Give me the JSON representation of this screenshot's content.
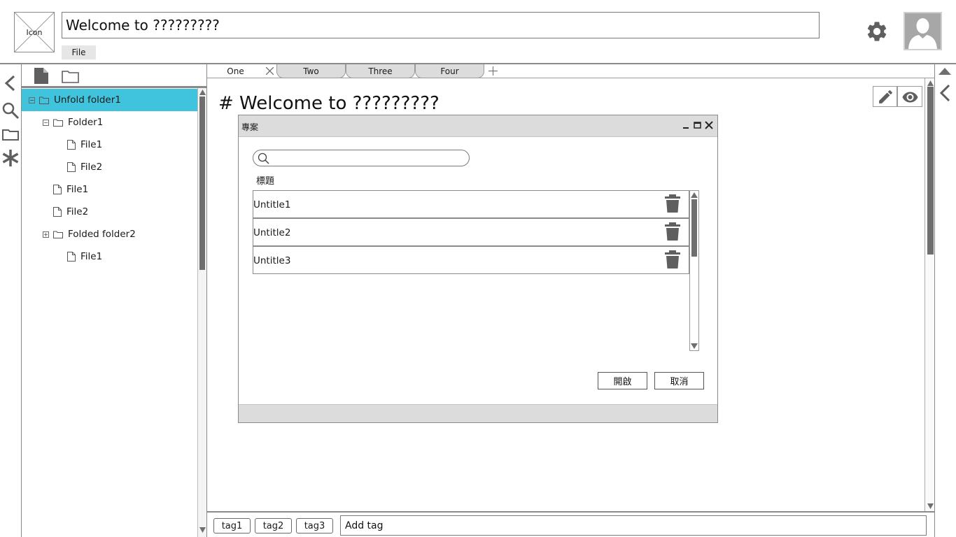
{
  "header": {
    "app_icon_label": "Icon",
    "title_value": "Welcome to ?????????",
    "menu": {
      "file_label": "File"
    }
  },
  "sidebar": {
    "tree": [
      {
        "label": "Unfold folder1",
        "type": "folder",
        "toggle": "−",
        "depth": 0,
        "selected": true
      },
      {
        "label": "Folder1",
        "type": "folder",
        "toggle": "−",
        "depth": 1
      },
      {
        "label": "File1",
        "type": "file",
        "depth": 2
      },
      {
        "label": "File2",
        "type": "file",
        "depth": 2
      },
      {
        "label": "File1",
        "type": "file",
        "depth": 1
      },
      {
        "label": "File2",
        "type": "file",
        "depth": 1
      },
      {
        "label": "Folded folder2",
        "type": "folder",
        "toggle": "+",
        "depth": 1
      },
      {
        "label": "File1",
        "type": "file",
        "depth": 2
      }
    ]
  },
  "tabs": [
    {
      "label": "One",
      "active": true
    },
    {
      "label": "Two"
    },
    {
      "label": "Three"
    },
    {
      "label": "Four"
    }
  ],
  "main": {
    "heading": "# Welcome to ?????????"
  },
  "dialog": {
    "title": "專案",
    "search_value": "",
    "list_header": "標題",
    "items": [
      "Untitle1",
      "Untitle2",
      "Untitle3"
    ],
    "open_label": "開啟",
    "cancel_label": "取消"
  },
  "tagbar": {
    "tags": [
      "tag1",
      "tag2",
      "tag3"
    ],
    "add_tag_value": "Add tag"
  },
  "colors": {
    "selected_row": "#40c4dd",
    "chrome_gray": "#dcdcdc",
    "icon_gray": "#5f5f5f"
  }
}
